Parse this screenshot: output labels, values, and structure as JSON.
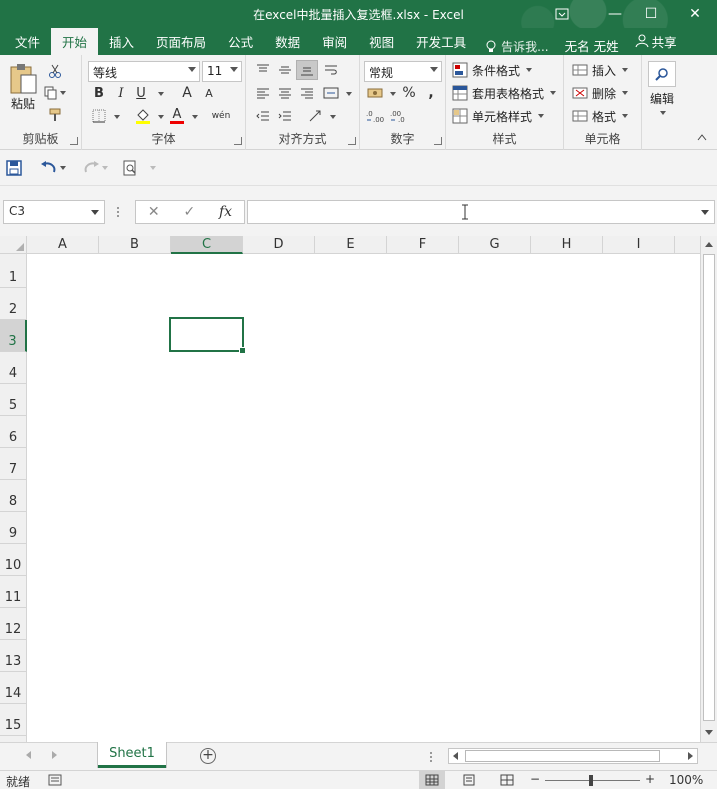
{
  "window": {
    "title": "在excel中批量插入复选框.xlsx - Excel",
    "buttons": {
      "minimize": "—",
      "restore": "❐",
      "maximize": "☐",
      "close": "✕"
    }
  },
  "tabs": [
    {
      "label": "文件"
    },
    {
      "label": "开始"
    },
    {
      "label": "插入"
    },
    {
      "label": "页面布局"
    },
    {
      "label": "公式"
    },
    {
      "label": "数据"
    },
    {
      "label": "审阅"
    },
    {
      "label": "视图"
    },
    {
      "label": "开发工具"
    }
  ],
  "tell_me": "告诉我...",
  "user_name": "无名 无姓",
  "share_label": "共享",
  "ribbon": {
    "clipboard": {
      "label": "剪贴板",
      "paste": "粘贴"
    },
    "font": {
      "label": "字体",
      "name": "等线",
      "size": "11",
      "bold": "B",
      "italic": "I",
      "underline": "U",
      "grow": "A",
      "shrink": "A",
      "font_color": "A",
      "phonetic": "wén"
    },
    "alignment": {
      "label": "对齐方式"
    },
    "number": {
      "label": "数字",
      "format": "常规",
      "percent": "%",
      "comma": ","
    },
    "styles": {
      "label": "样式",
      "conditional": "条件格式",
      "table": "套用表格格式",
      "cell_styles": "单元格样式"
    },
    "cells": {
      "label": "单元格",
      "insert": "插入",
      "delete": "删除",
      "format": "格式"
    },
    "editing": {
      "label": "编辑"
    }
  },
  "formula_bar": {
    "name_box": "C3",
    "cancel": "✕",
    "enter": "✓",
    "fx": "fx",
    "formula": ""
  },
  "columns": [
    "A",
    "B",
    "C",
    "D",
    "E",
    "F",
    "G",
    "H",
    "I"
  ],
  "rows": [
    "1",
    "2",
    "3",
    "4",
    "5",
    "6",
    "7",
    "8",
    "9",
    "10",
    "11",
    "12",
    "13",
    "14",
    "15"
  ],
  "selected_cell": {
    "column": "C",
    "row": "3"
  },
  "sheets": [
    {
      "name": "Sheet1",
      "active": true
    }
  ],
  "status": {
    "text": "就绪",
    "zoom": "100%",
    "zoom_minus": "−",
    "zoom_plus": "+"
  },
  "colors": {
    "accent": "#217346",
    "ribbon_bg": "#f3f3f3",
    "selected_header": "#d3d3d3"
  }
}
